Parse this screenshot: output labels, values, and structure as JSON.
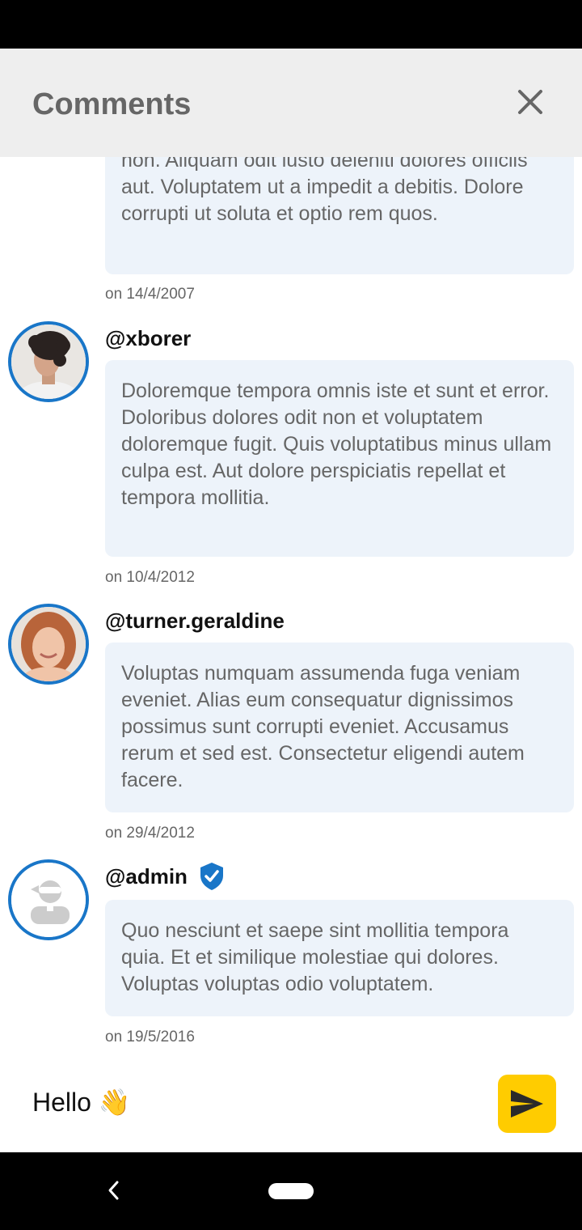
{
  "header": {
    "title": "Comments"
  },
  "comments": [
    {
      "text": "non. Aliquam odit iusto deleniti dolores officiis aut. Voluptatem ut a impedit a debitis. Dolore corrupti ut soluta et optio rem quos.",
      "date": "on 14/4/2007"
    },
    {
      "username": "@xborer",
      "text": "Doloremque tempora omnis iste et sunt et error. Doloribus dolores odit non et voluptatem doloremque fugit. Quis voluptatibus minus ullam culpa est. Aut dolore perspiciatis repellat et tempora mollitia.",
      "date": "on 10/4/2012"
    },
    {
      "username": "@turner.geraldine",
      "text": "Voluptas numquam assumenda fuga veniam eveniet. Alias eum consequatur dignissimos possimus sunt corrupti eveniet. Accusamus rerum et sed est. Consectetur eligendi autem facere.",
      "date": "on 29/4/2012"
    },
    {
      "username": "@admin",
      "verified": true,
      "text": "Quo nesciunt et saepe sint mollitia tempora quia. Et et similique molestiae qui dolores. Voluptas voluptas odio voluptatem.",
      "date": "on 19/5/2016"
    }
  ],
  "composer": {
    "value": "Hello 👋"
  },
  "icons": {
    "close": "close-icon",
    "send": "send-icon",
    "verified": "verified-badge-icon",
    "back": "nav-back-icon"
  },
  "colors": {
    "accent": "#1976c8",
    "send_button": "#ffcc00",
    "bubble": "#edf3fa",
    "header": "#eeeeee"
  }
}
